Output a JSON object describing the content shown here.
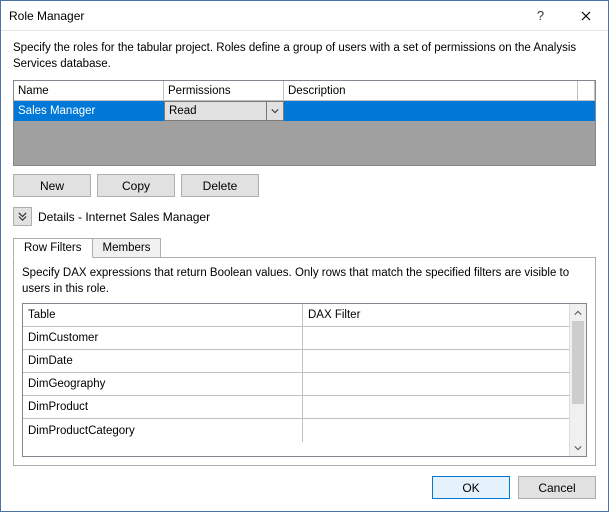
{
  "window": {
    "title": "Role Manager"
  },
  "instruction": "Specify the roles for the tabular project. Roles define a group of users with a set of permissions on the Analysis Services database.",
  "roles_grid": {
    "columns": {
      "name": "Name",
      "permissions": "Permissions",
      "description": "Description"
    },
    "rows": [
      {
        "name": "Sales Manager",
        "permission": "Read",
        "description": ""
      }
    ]
  },
  "buttons": {
    "new": "New",
    "copy": "Copy",
    "delete": "Delete"
  },
  "details": {
    "label": "Details - Internet Sales Manager"
  },
  "tabs": {
    "row_filters": "Row Filters",
    "members": "Members"
  },
  "row_filters": {
    "instruction": "Specify DAX expressions that return Boolean values. Only rows that match the specified filters are visible to users in this role.",
    "columns": {
      "table": "Table",
      "dax": "DAX Filter"
    },
    "rows": [
      {
        "table": "DimCustomer",
        "dax": ""
      },
      {
        "table": "DimDate",
        "dax": ""
      },
      {
        "table": "DimGeography",
        "dax": ""
      },
      {
        "table": "DimProduct",
        "dax": ""
      },
      {
        "table": "DimProductCategory",
        "dax": ""
      }
    ]
  },
  "footer": {
    "ok": "OK",
    "cancel": "Cancel"
  }
}
